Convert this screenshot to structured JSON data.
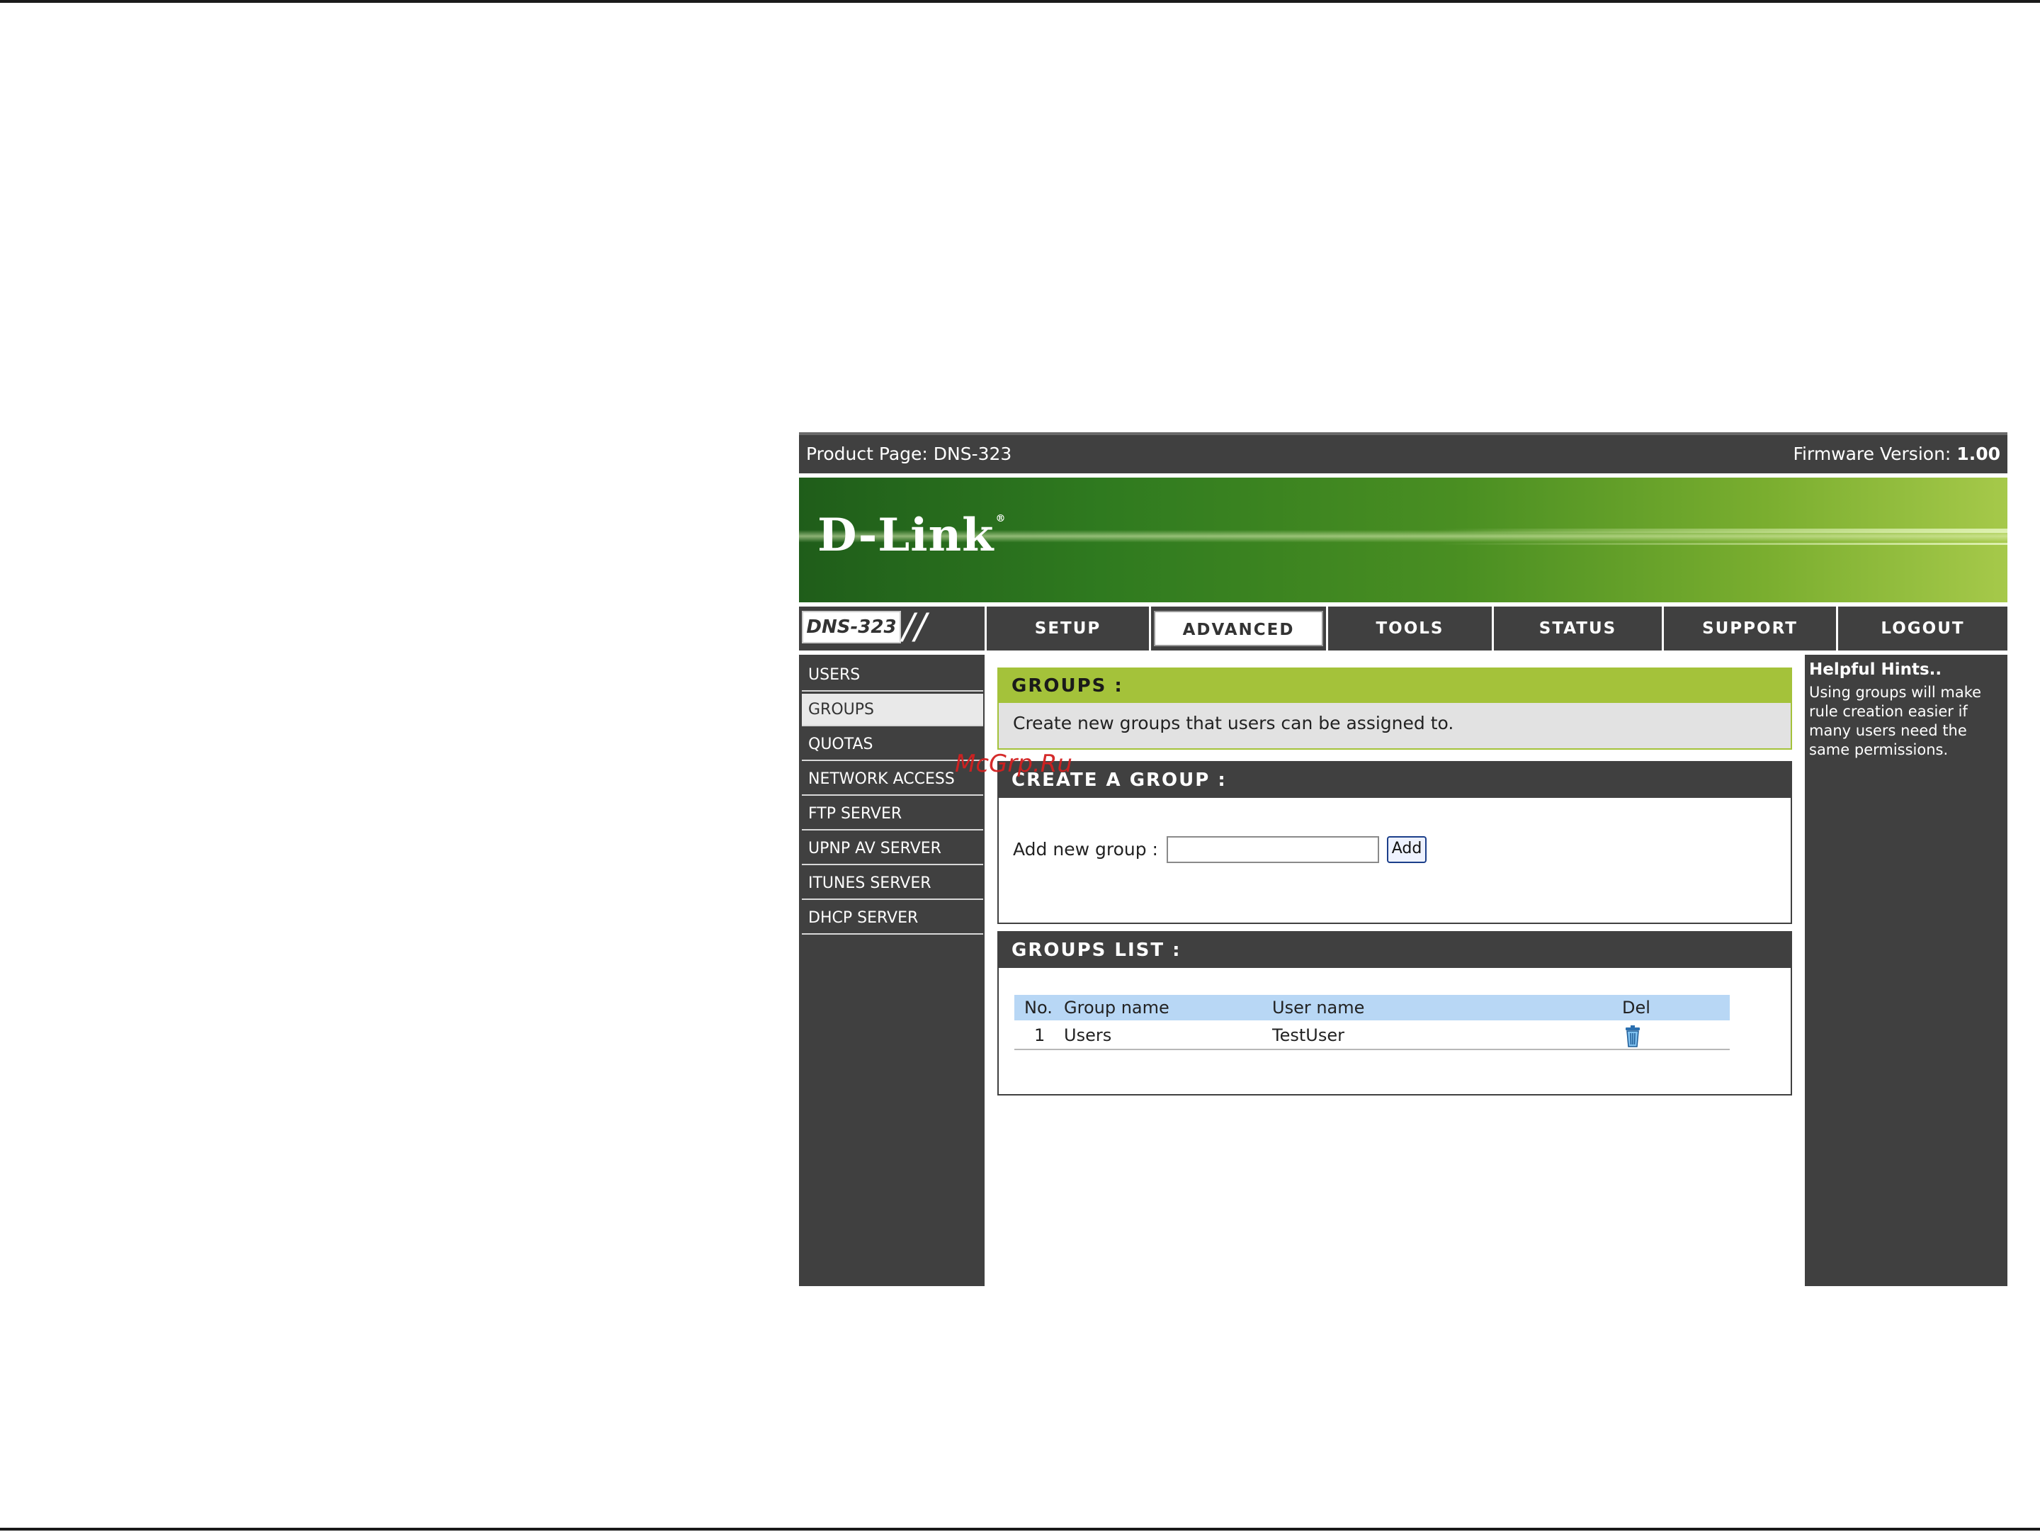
{
  "topbar": {
    "product_label": "Product Page: DNS-323",
    "firmware_label": "Firmware Version:",
    "firmware_value": "1.00"
  },
  "banner": {
    "logo_text": "D-Link",
    "logo_mark": "®"
  },
  "nav": {
    "model": "DNS-323",
    "tabs": [
      {
        "label": "SETUP",
        "active": false
      },
      {
        "label": "ADVANCED",
        "active": true
      },
      {
        "label": "TOOLS",
        "active": false
      },
      {
        "label": "STATUS",
        "active": false
      },
      {
        "label": "SUPPORT",
        "active": false
      },
      {
        "label": "LOGOUT",
        "active": false
      }
    ]
  },
  "sidebar": {
    "items": [
      {
        "label": "USERS",
        "active": false
      },
      {
        "label": "GROUPS",
        "active": true
      },
      {
        "label": "QUOTAS",
        "active": false
      },
      {
        "label": "NETWORK ACCESS",
        "active": false
      },
      {
        "label": "FTP SERVER",
        "active": false
      },
      {
        "label": "UPNP AV SERVER",
        "active": false
      },
      {
        "label": "ITUNES SERVER",
        "active": false
      },
      {
        "label": "DHCP SERVER",
        "active": false
      }
    ]
  },
  "groups_section": {
    "title": "GROUPS :",
    "description": "Create new groups that users can be assigned to."
  },
  "create_section": {
    "title": "CREATE A GROUP :",
    "field_label": "Add new group :",
    "field_value": "",
    "add_button": "Add"
  },
  "list_section": {
    "title": "GROUPS LIST :",
    "columns": {
      "no": "No.",
      "group": "Group name",
      "user": "User name",
      "del": "Del"
    },
    "rows": [
      {
        "no": "1",
        "group": "Users",
        "user": "TestUser",
        "del_icon": "trash-icon"
      }
    ]
  },
  "hints": {
    "title": "Helpful Hints..",
    "text": "Using groups will make rule creation easier if many users need the same permissions."
  },
  "watermark": "McGrp.Ru",
  "colors": {
    "accent_green": "#a4c23a",
    "dark_panel": "#404040",
    "table_header": "#b8d7f5"
  }
}
